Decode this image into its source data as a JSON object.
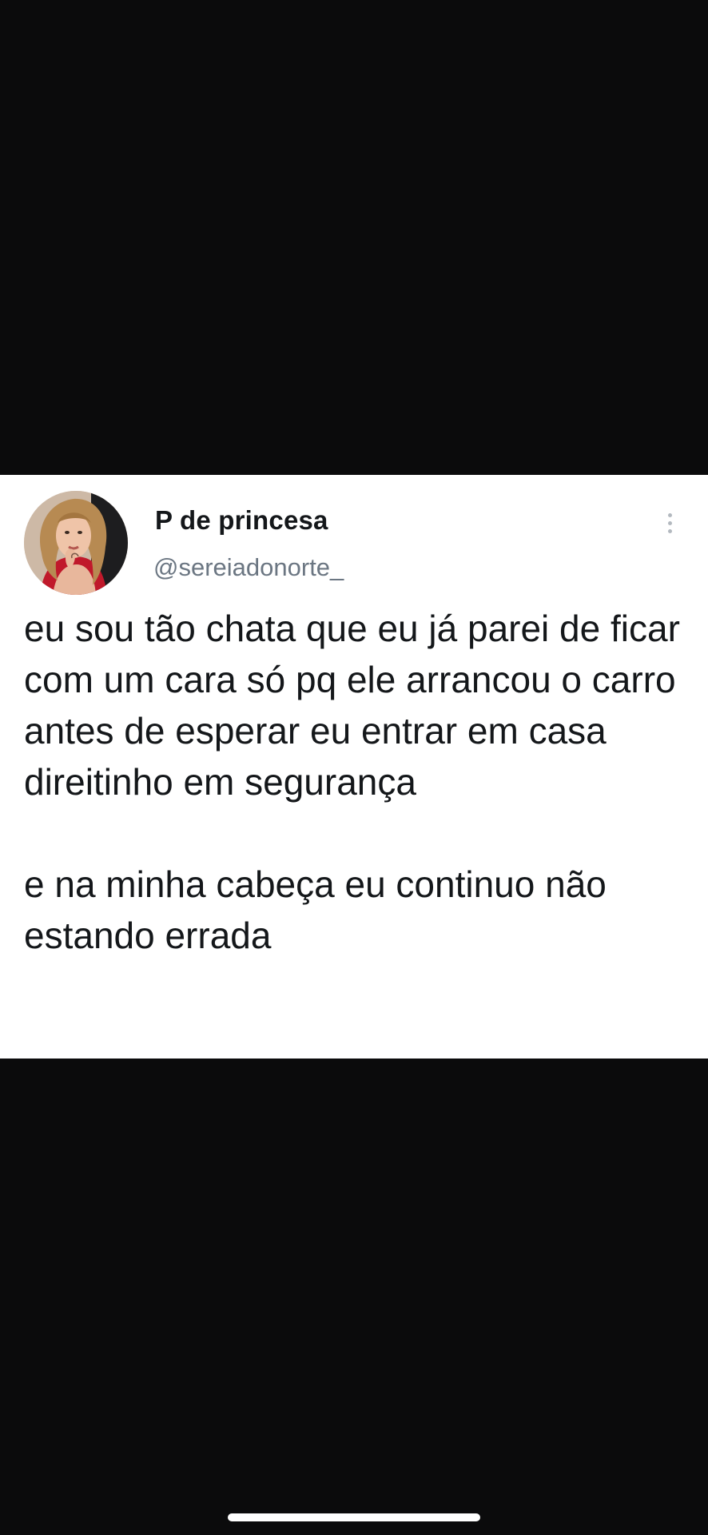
{
  "tweet": {
    "display_name": "P de princesa",
    "handle": "@sereiadonorte_",
    "paragraphs": [
      "eu sou tão chata que eu já parei de ficar com um cara só pq ele arrancou o carro antes de esperar eu entrar em casa direitinho em segurança",
      "e na minha cabeça eu continuo não estando errada"
    ],
    "more_icon": "more-vertical-icon",
    "avatar_icon": "avatar-photo"
  },
  "colors": {
    "background": "#0b0b0c",
    "card": "#ffffff",
    "text": "#14171a",
    "secondary_text": "#6b7682",
    "home_indicator": "#ffffff"
  }
}
